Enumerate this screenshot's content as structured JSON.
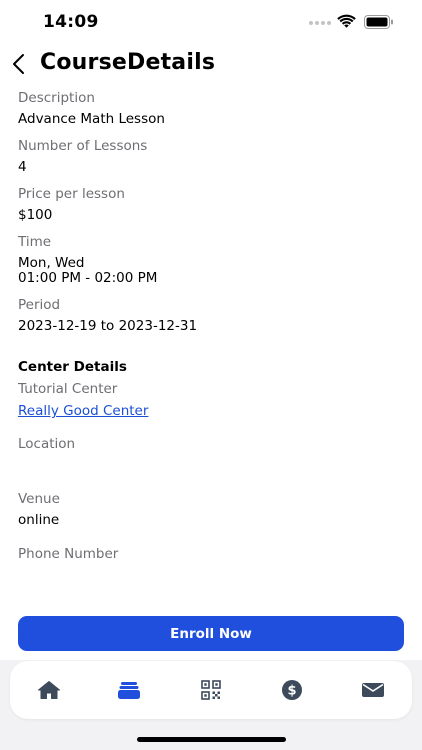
{
  "status_bar": {
    "time": "14:09"
  },
  "header": {
    "title": "CourseDetails"
  },
  "course": {
    "description_label": "Description",
    "description_value": "Advance Math Lesson",
    "lessons_label": "Number of Lessons",
    "lessons_value": "4",
    "price_label": "Price per lesson",
    "price_value": "$100",
    "time_label": "Time",
    "time_days": "Mon, Wed",
    "time_range": "01:00 PM - 02:00 PM",
    "period_label": "Period",
    "period_value": "2023-12-19 to 2023-12-31"
  },
  "center": {
    "section_title": "Center Details",
    "tutorial_center_label": "Tutorial Center",
    "tutorial_center_value": "Really Good Center",
    "location_label": "Location",
    "venue_label": "Venue",
    "venue_value": "online",
    "phone_label": "Phone Number"
  },
  "actions": {
    "enroll_label": "Enroll Now"
  },
  "tab_bar": {
    "items": [
      {
        "icon": "home-icon"
      },
      {
        "icon": "courses-icon",
        "active": true
      },
      {
        "icon": "qr-code-icon"
      },
      {
        "icon": "dollar-icon"
      },
      {
        "icon": "mail-icon"
      }
    ]
  },
  "colors": {
    "accent": "#1f4fdc",
    "link": "#1a4fd6",
    "label": "#6e6e73",
    "tab_inactive": "#3c4a5c"
  }
}
